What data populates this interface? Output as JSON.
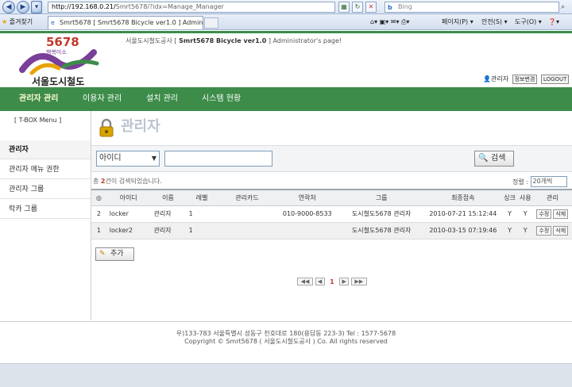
{
  "browser": {
    "url_host": "http://192.168.0.21/",
    "url_path": "Smrt5678/?idx=Manage_Manager",
    "search_placeholder": "Bing",
    "favorites_label": "즐겨찾기",
    "tab_title": "Smrt5678 [ Smrt5678 Bicycle ver1.0 ] Adminis...",
    "commands": {
      "page": "페이지(P) ▾",
      "safety": "안전(S) ▾",
      "tools": "도구(O) ▾",
      "help": "❓▾"
    }
  },
  "header": {
    "logo_number": "5678",
    "logo_slogan": "행복미소",
    "logo_name": "서울도시철도",
    "welcome_org": "서울도시철도공사 [",
    "welcome_app": "Smrt5678 Bicycle ver1.0",
    "welcome_tail": "] Administrator's page!",
    "user_label": "관리자",
    "edit_info_label": "정보변경",
    "logout_label": "LOGOUT"
  },
  "menu": {
    "items": [
      {
        "label": "관리자 관리",
        "active": true
      },
      {
        "label": "이용자 관리",
        "active": false
      },
      {
        "label": "설치 관리",
        "active": false
      },
      {
        "label": "시스템 현황",
        "active": false
      }
    ]
  },
  "sidebar": {
    "title": "[ T-BOX Menu ]",
    "items": [
      {
        "label": "관리자",
        "active": true
      },
      {
        "label": "관리자 메뉴 권한",
        "active": false
      },
      {
        "label": "관리자 그룹",
        "active": false
      },
      {
        "label": "락카 그룹",
        "active": false
      }
    ]
  },
  "content": {
    "title": "관리자",
    "search": {
      "field_selected": "아이디",
      "keyword_value": "",
      "button_label": "검색"
    },
    "count_prefix": "총",
    "count_value": "2",
    "count_suffix": "건이 검색되었습니다.",
    "sort_label": "정렬 :",
    "sort_selected": "20개씩",
    "table": {
      "columns": [
        "◎",
        "아이디",
        "이름",
        "레벨",
        "관리카드",
        "연락처",
        "그룹",
        "최종접속",
        "싱크",
        "사용",
        "관리"
      ],
      "rows": [
        {
          "no": "2",
          "id": "locker",
          "name": "관리자",
          "level": "1",
          "card": "",
          "phone": "010-9000-8533",
          "group": "도시철도5678 관리자",
          "last_login": "2010-07-21 15:12:44",
          "sync": "Y",
          "use": "Y",
          "edit": "수정",
          "delete": "삭제"
        },
        {
          "no": "1",
          "id": "locker2",
          "name": "관리자",
          "level": "1",
          "card": "",
          "phone": "",
          "group": "도시철도5678 관리자",
          "last_login": "2010-03-15 07:19:46",
          "sync": "Y",
          "use": "Y",
          "edit": "수정",
          "delete": "삭제"
        }
      ]
    },
    "add_label": "추가",
    "pager": {
      "first": "◀◀",
      "prev": "◀",
      "current": "1",
      "next": "▶",
      "last": "▶▶"
    }
  },
  "footer": {
    "line1": "우)133-783 서울특별시 성동구 천호대로 180(용답동 223-3) Tel : 1577-5678",
    "line2": "Copyright © Smrt5678 ( 서울도시철도공사 ) Co. All rights reserved"
  },
  "colors": {
    "brand_green": "#3d8c4a",
    "accent_red": "#c0392b"
  }
}
